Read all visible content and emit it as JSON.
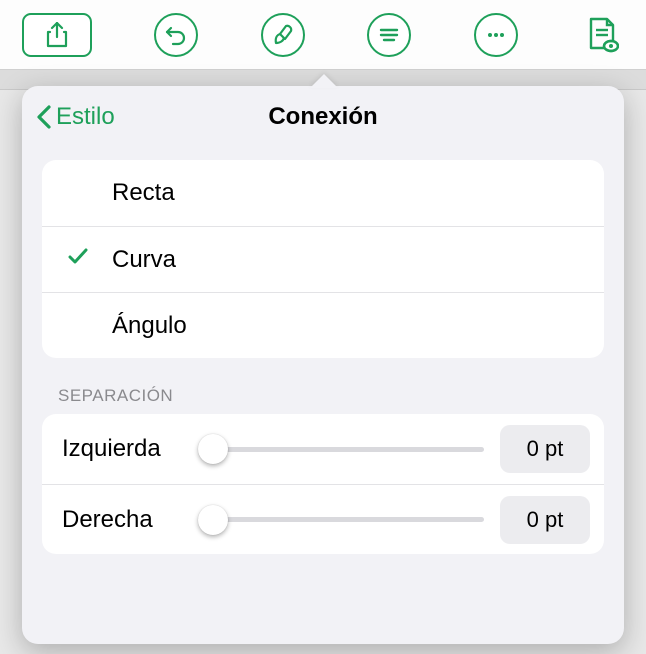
{
  "toolbar": {
    "share": "share-icon",
    "undo": "undo-icon",
    "format": "brush-icon",
    "doc_options": "lines-icon",
    "more": "more-icon",
    "presenter": "doc-eye-icon"
  },
  "popover": {
    "back_label": "Estilo",
    "title": "Conexión",
    "options": [
      {
        "label": "Recta",
        "selected": false
      },
      {
        "label": "Curva",
        "selected": true
      },
      {
        "label": "Ángulo",
        "selected": false
      }
    ],
    "section_label": "SEPARACIÓN",
    "sliders": {
      "left": {
        "label": "Izquierda",
        "value": "0 pt"
      },
      "right": {
        "label": "Derecha",
        "value": "0 pt"
      }
    }
  }
}
